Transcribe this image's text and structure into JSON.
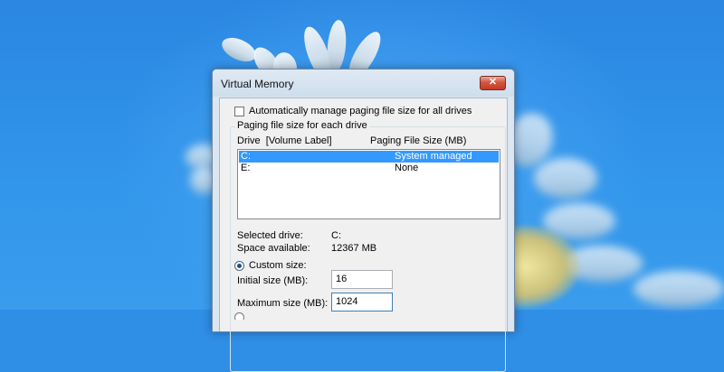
{
  "dialog": {
    "title": "Virtual Memory",
    "close_glyph": "✕",
    "auto_manage_label": "Automatically manage paging file size for all drives",
    "auto_manage_checked": false,
    "group_label": "Paging file size for each drive",
    "columns": {
      "drive": "Drive  [Volume Label]",
      "size": "Paging File Size (MB)"
    },
    "drives": [
      {
        "drive": "C:",
        "size": "System managed",
        "selected": true
      },
      {
        "drive": "E:",
        "size": "None",
        "selected": false
      }
    ],
    "selected_drive": {
      "label": "Selected drive:",
      "value": "C:"
    },
    "space_available": {
      "label": "Space available:",
      "value": "12367 MB"
    },
    "custom_size_label": "Custom size:",
    "initial_size": {
      "label": "Initial size (MB):",
      "value": "16"
    },
    "maximum_size": {
      "label": "Maximum size (MB):",
      "value": "1024"
    }
  },
  "colors": {
    "desktop_blue": "#2f8ee6",
    "selection": "#3399ff",
    "close_red": "#c23b24"
  }
}
